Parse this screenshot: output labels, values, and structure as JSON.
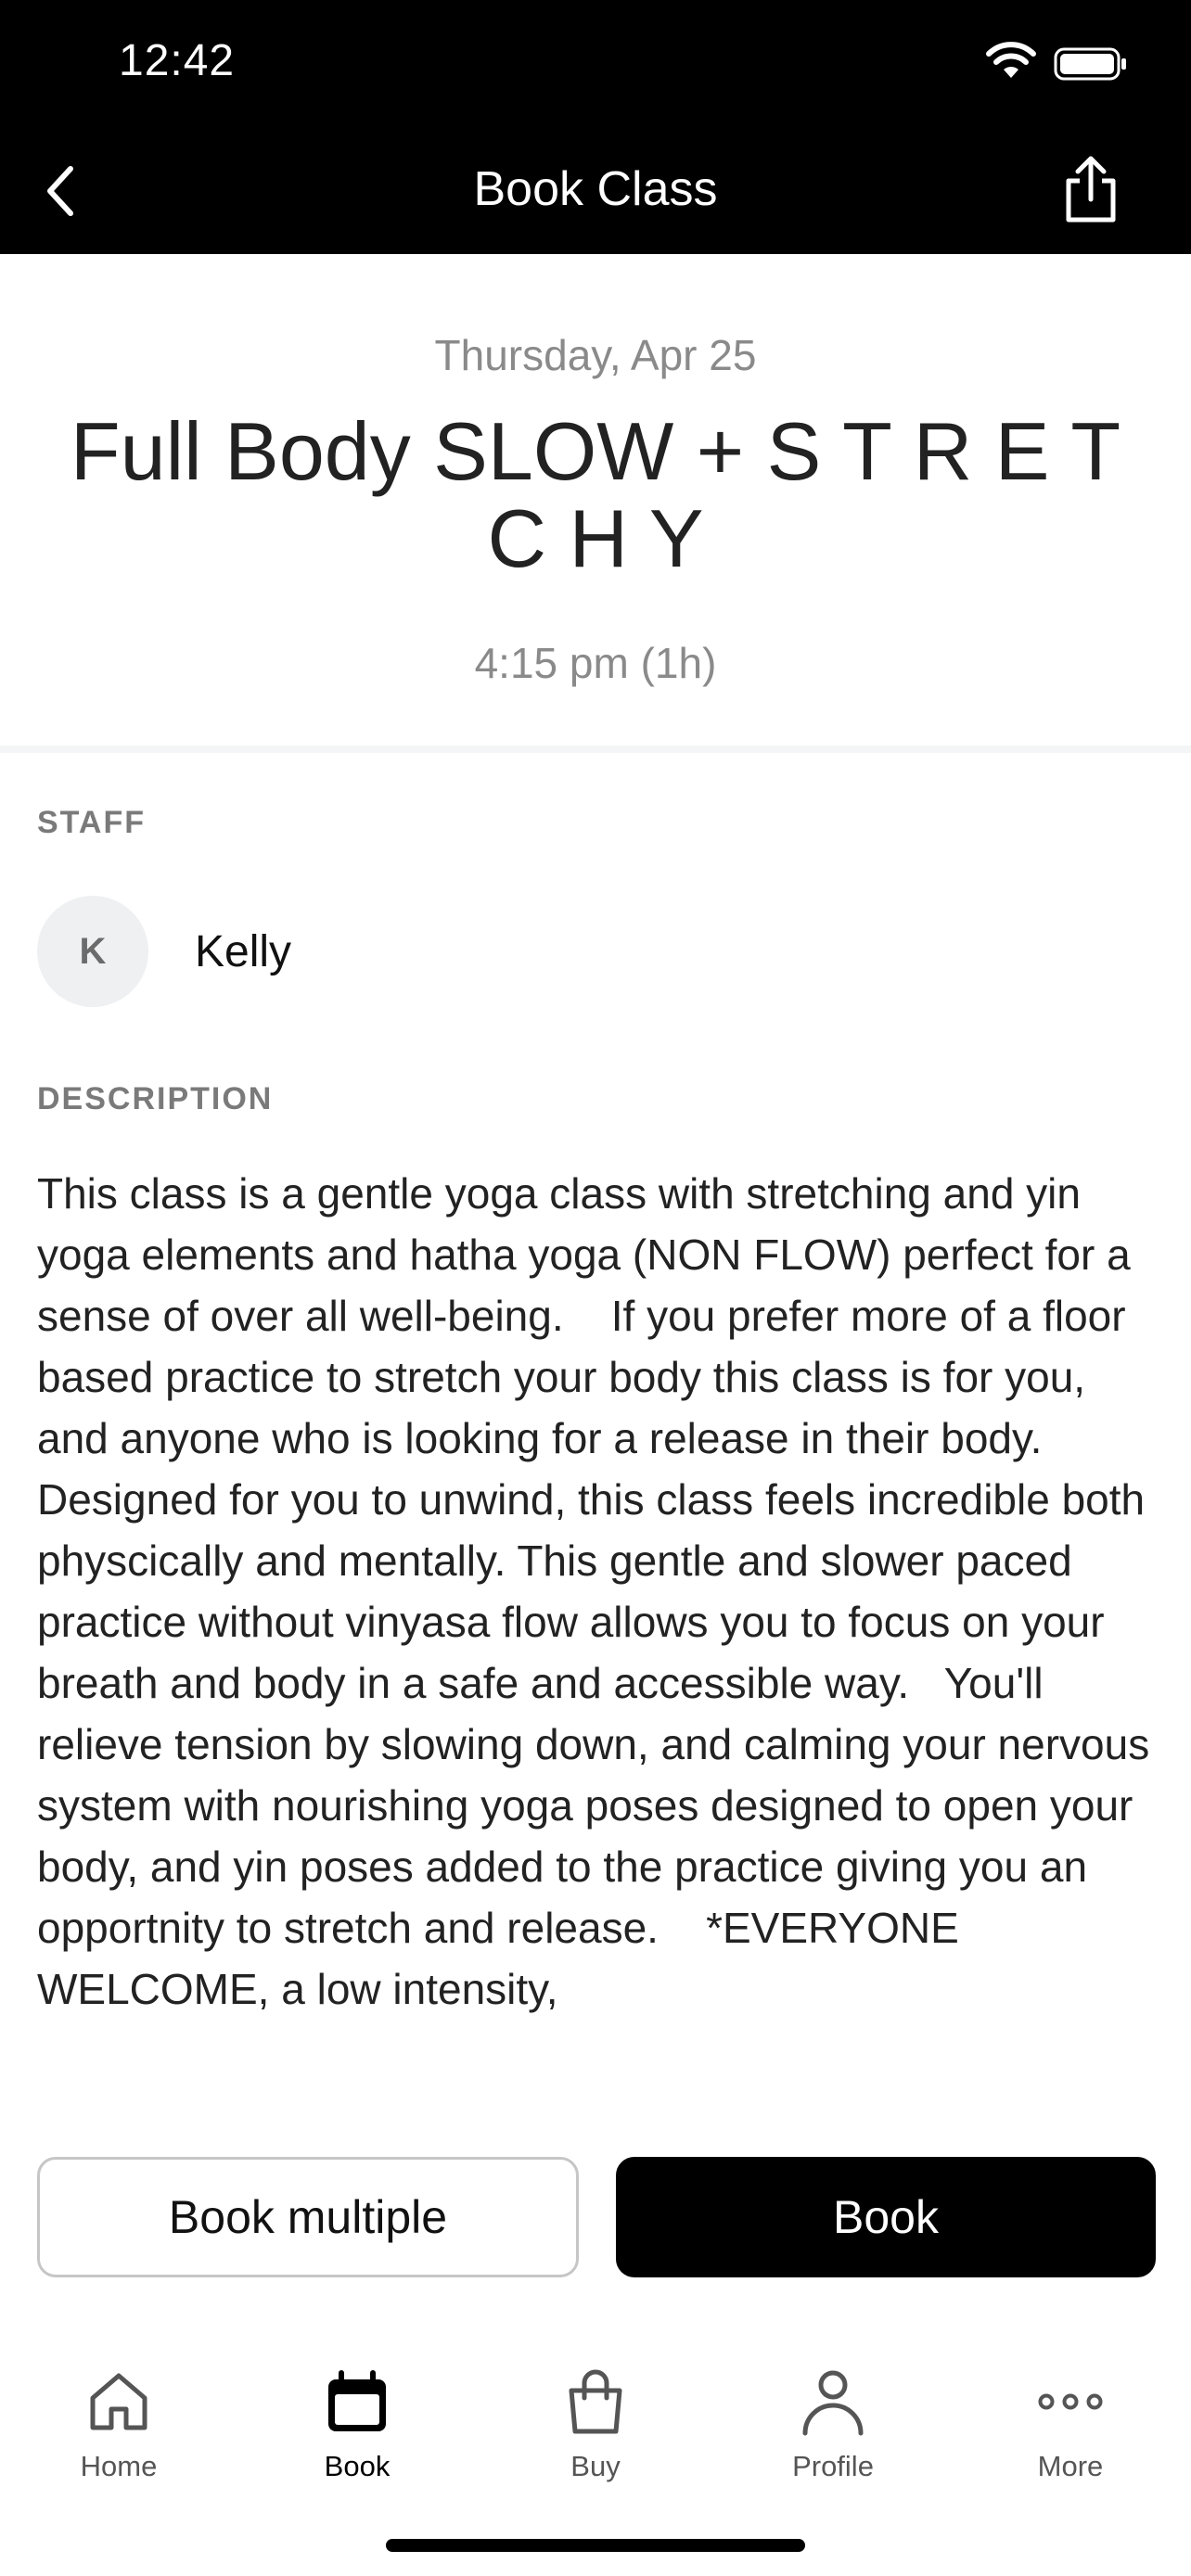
{
  "status_bar": {
    "time": "12:42"
  },
  "nav": {
    "title": "Book Class"
  },
  "class": {
    "date": "Thursday, Apr 25",
    "title": "Full Body SLOW + S T R E T C H Y",
    "time": "4:15 pm (1h)"
  },
  "staff": {
    "label": "STAFF",
    "initial": "K",
    "name": "Kelly"
  },
  "description": {
    "label": "DESCRIPTION",
    "text": "This class is a gentle yoga class with stretching and yin yoga elements and hatha yoga (NON FLOW) perfect for a sense of over all well-being.    If you prefer more of a floor based practice to stretch your body this class is for you, and anyone who is looking for a release in their body.   Designed for you to unwind, this class feels incredible both physcically and mentally. This gentle and slower paced practice without vinyasa flow allows you to focus on your breath and body in a safe and accessible way.   You'll relieve tension by slowing down, and calming your nervous system with nourishing yoga poses designed to open your body, and yin poses added to the practice giving you an opportnity to stretch and release.    *EVERYONE WELCOME, a low intensity,"
  },
  "actions": {
    "book_multiple": "Book multiple",
    "book": "Book"
  },
  "tabs": [
    {
      "label": "Home",
      "icon": "home-icon",
      "active": false
    },
    {
      "label": "Book",
      "icon": "calendar-icon",
      "active": true
    },
    {
      "label": "Buy",
      "icon": "shopping-bag-icon",
      "active": false
    },
    {
      "label": "Profile",
      "icon": "person-icon",
      "active": false
    },
    {
      "label": "More",
      "icon": "more-dots-icon",
      "active": false
    }
  ],
  "colors": {
    "bar_background": "#000000",
    "muted_text": "#8a8a8a",
    "accent": "#000000"
  }
}
